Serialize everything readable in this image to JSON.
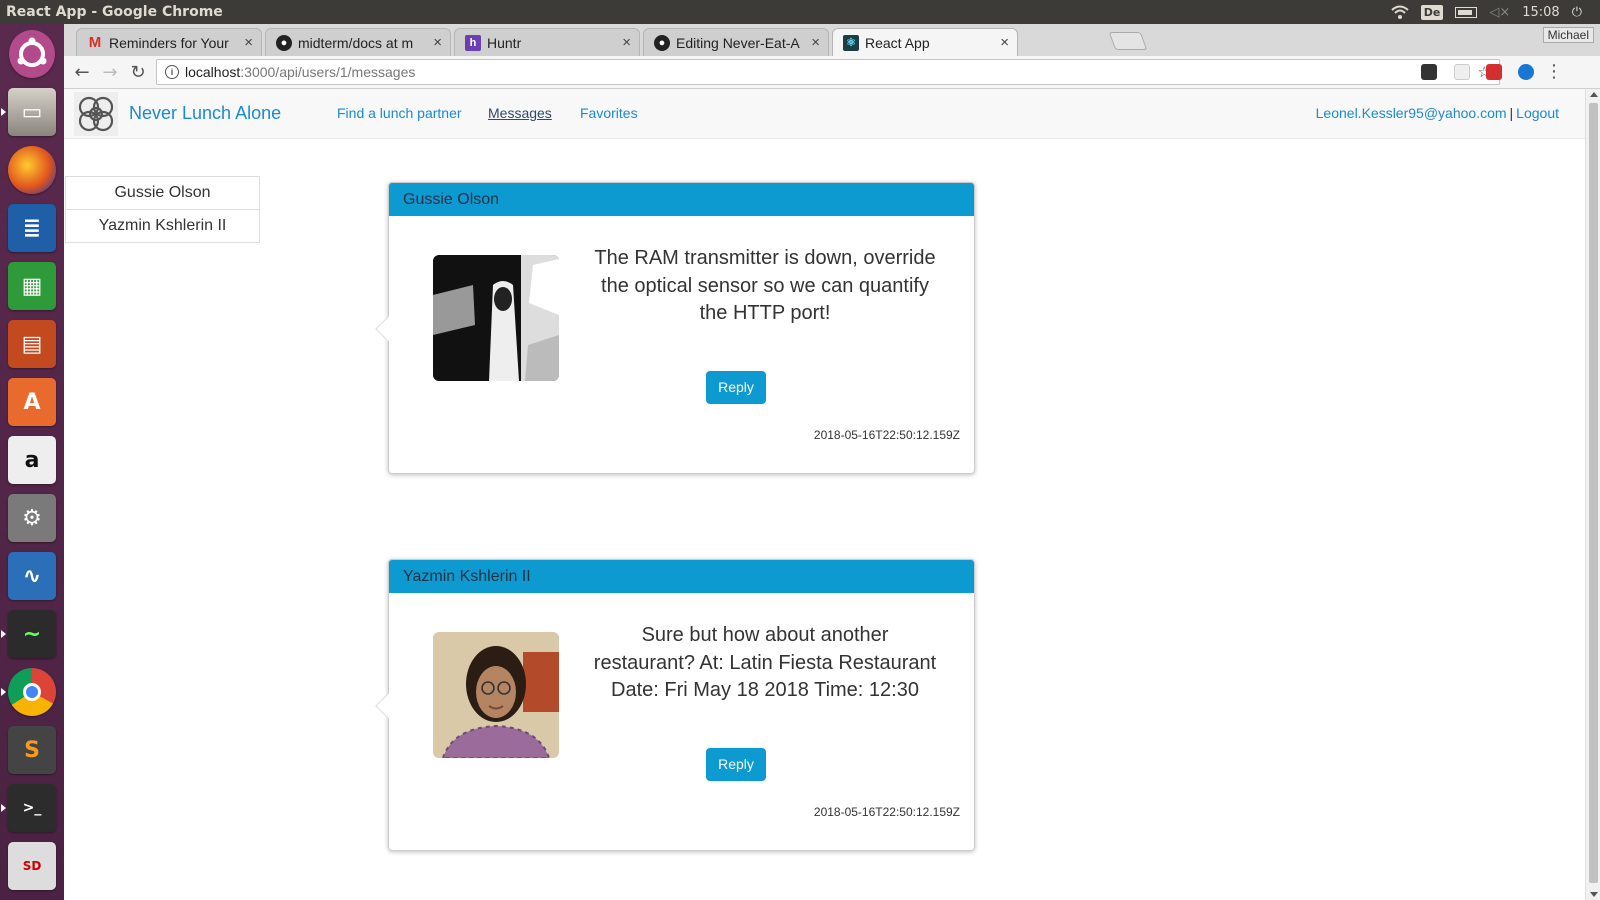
{
  "os": {
    "window_title": "React App - Google Chrome",
    "keyboard_layout": "De",
    "clock": "15:08"
  },
  "browser": {
    "profile": "Michael",
    "tabs": [
      {
        "label": "Reminders for Your",
        "favicon": "gmail-icon"
      },
      {
        "label": "midterm/docs at m",
        "favicon": "github-icon"
      },
      {
        "label": "Huntr",
        "favicon": "huntr-icon"
      },
      {
        "label": "Editing Never-Eat-A",
        "favicon": "github-icon"
      },
      {
        "label": "React App",
        "favicon": "react-icon",
        "active": true
      }
    ],
    "url_host": "localhost",
    "url_path": ":3000/api/users/1/messages"
  },
  "app": {
    "brand": "Never Lunch Alone",
    "nav": {
      "find": "Find a lunch partner",
      "messages": "Messages",
      "favorites": "Favorites"
    },
    "user_email": "Leonel.Kessler95@yahoo.com",
    "separator": "|",
    "logout": "Logout",
    "contacts": [
      "Gussie Olson",
      "Yazmin Kshlerin II"
    ],
    "messages": [
      {
        "sender": "Gussie Olson",
        "text": "The RAM transmitter is down, override the optical sensor so we can quantify the HTTP port!",
        "reply_label": "Reply",
        "timestamp": "2018-05-16T22:50:12.159Z"
      },
      {
        "sender": "Yazmin Kshlerin II",
        "text": "Sure but how about another restaurant? At: Latin Fiesta Restaurant Date: Fri May 18 2018 Time: 12:30",
        "reply_label": "Reply",
        "timestamp": "2018-05-16T22:50:12.159Z"
      }
    ]
  },
  "colors": {
    "accent": "#0d9ad0",
    "link": "#1a8ad1",
    "launcher": "#4b2243"
  }
}
